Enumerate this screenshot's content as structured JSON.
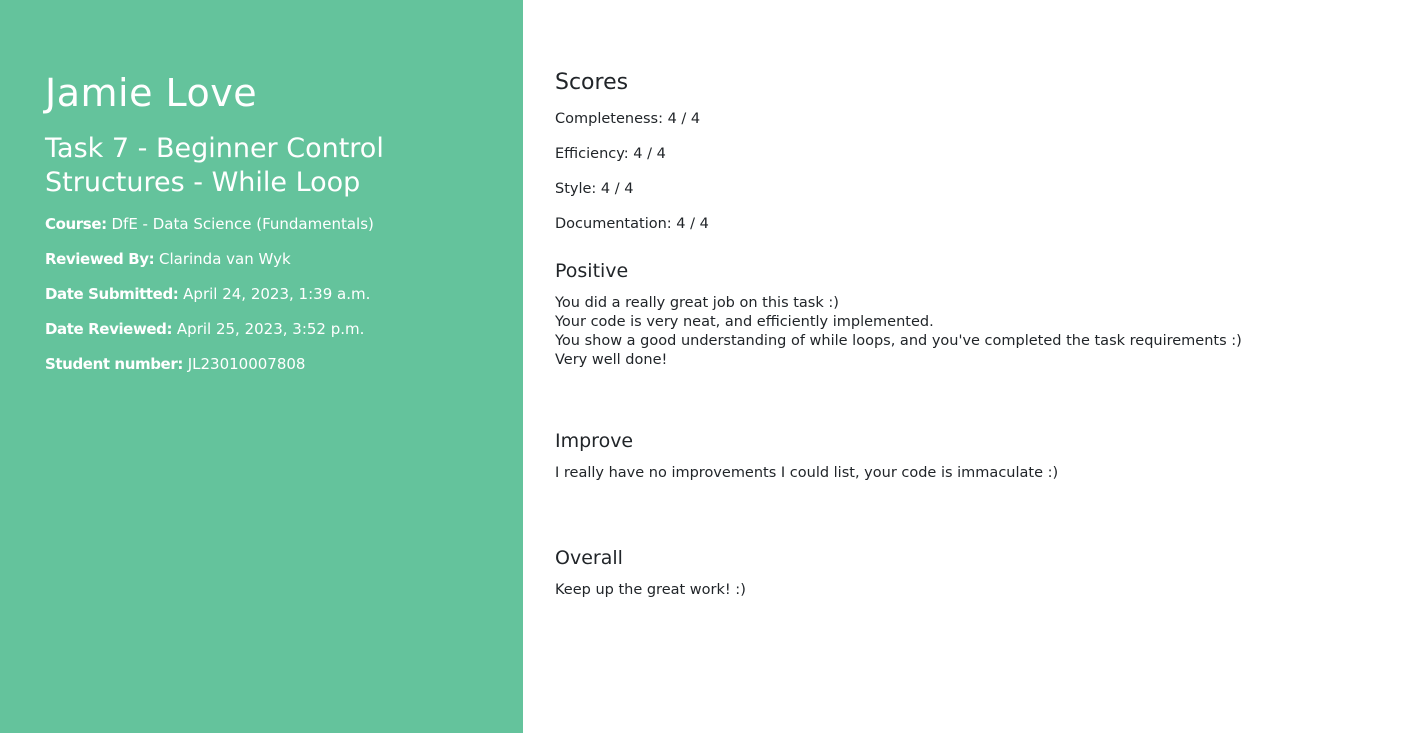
{
  "student": {
    "name": "Jamie Love",
    "task": "Task 7 - Beginner Control Structures - While Loop",
    "meta": [
      {
        "label": "Course:",
        "value": "DfE - Data Science (Fundamentals)"
      },
      {
        "label": "Reviewed By:",
        "value": "Clarinda van Wyk"
      },
      {
        "label": "Date Submitted:",
        "value": "April 24, 2023, 1:39 a.m."
      },
      {
        "label": "Date Reviewed:",
        "value": "April 25, 2023, 3:52 p.m."
      },
      {
        "label": "Student number:",
        "value": "JL23010007808"
      }
    ]
  },
  "scores": {
    "heading": "Scores",
    "items": [
      "Completeness: 4 / 4",
      "Efficiency: 4 / 4",
      "Style: 4 / 4",
      "Documentation: 4 / 4"
    ]
  },
  "positive": {
    "heading": "Positive",
    "lines": [
      "You did a really great job on this task :)",
      "Your code is very neat, and efficiently implemented.",
      "You show a good understanding of while loops, and you've completed the task requirements :)",
      "Very well done!"
    ]
  },
  "improve": {
    "heading": "Improve",
    "text": "I really have no improvements I could list, your code is immaculate :)"
  },
  "overall": {
    "heading": "Overall",
    "text": "Keep up the great work! :)"
  },
  "colors": {
    "sidebar": "#64c39c"
  }
}
